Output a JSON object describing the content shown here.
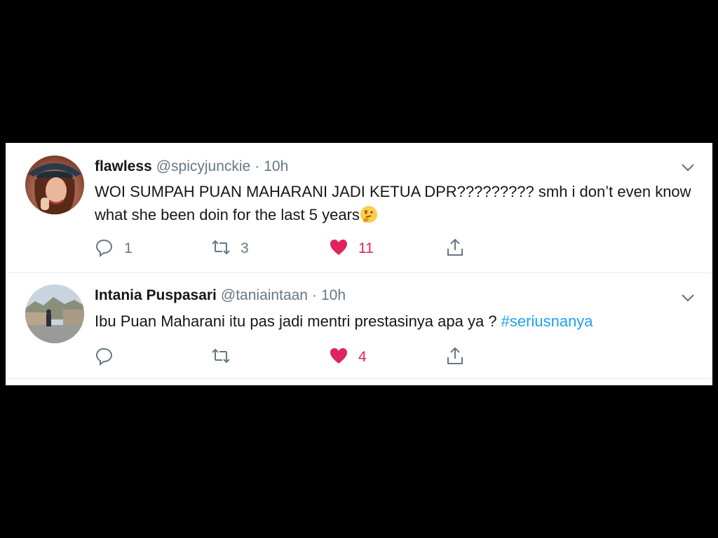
{
  "tweets": [
    {
      "name": "flawless",
      "handle": "@spicyjunckie",
      "separator": "·",
      "time": "10h",
      "text": "WOI SUMPAH PUAN MAHARANI JADI KETUA DPR????????? smh i don’t even know what she been doin for the last 5 years",
      "emoji": "thinking-face",
      "reply_count": "1",
      "retweet_count": "3",
      "like_count": "11",
      "liked": true
    },
    {
      "name": "Intania Puspasari",
      "handle": "@taniaintaan",
      "separator": "·",
      "time": "10h",
      "text": "Ibu Puan Maharani itu pas jadi mentri prestasinya apa ya ? ",
      "hashtag": "#seriusnanya",
      "reply_count": "",
      "retweet_count": "",
      "like_count": "4",
      "liked": true
    }
  ],
  "colors": {
    "background": "#000000",
    "card": "#ffffff",
    "name": "#14171a",
    "meta": "#657786",
    "like": "#e0245e",
    "hashtag": "#1da1f2"
  },
  "icons": [
    "reply-icon",
    "retweet-icon",
    "heart-icon",
    "share-icon",
    "chevron-down-icon"
  ]
}
